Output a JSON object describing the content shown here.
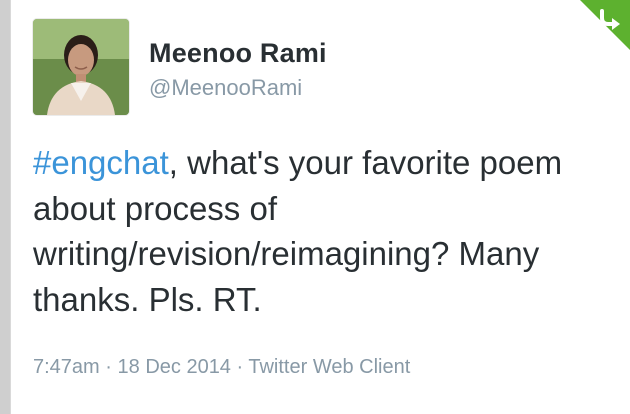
{
  "tweet": {
    "author_name": "Meenoo Rami",
    "author_handle": "@MeenooRami",
    "hashtag": "#engchat",
    "text_rest": ", what's your favorite poem about process of writing/revision/reimagining? Many thanks. Pls. RT.",
    "time": "7:47am",
    "date": "18 Dec 2014",
    "client": "Twitter Web Client",
    "separator": "·"
  },
  "icons": {
    "corner": "green-retweet-corner-icon",
    "avatar": "user-avatar-photo"
  },
  "colors": {
    "hashtag": "#3b94d9",
    "corner": "#5db12f",
    "muted_text": "#8899a6",
    "primary_text": "#292f33"
  }
}
